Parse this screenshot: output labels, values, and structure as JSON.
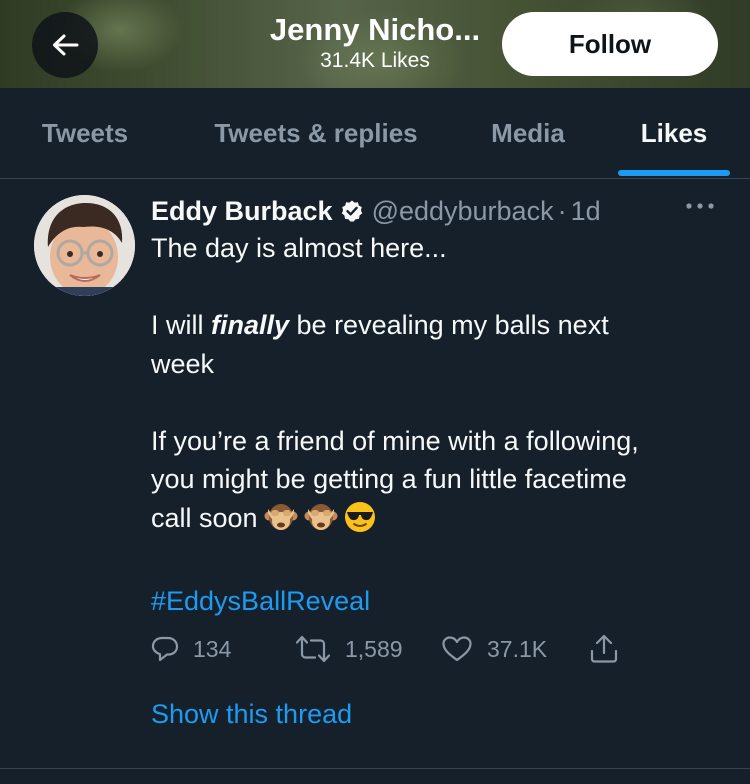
{
  "header": {
    "title": "Jenny Nicho...",
    "subtitle": "31.4K Likes",
    "follow_label": "Follow",
    "back_icon": "arrow-left-icon"
  },
  "tabs": [
    {
      "label": "Tweets",
      "active": false
    },
    {
      "label": "Tweets & replies",
      "active": false
    },
    {
      "label": "Media",
      "active": false
    },
    {
      "label": "Likes",
      "active": true
    }
  ],
  "tweet": {
    "author_name": "Eddy Burback",
    "verified": true,
    "handle": "@eddyburback",
    "separator": "·",
    "age": "1d",
    "lines": {
      "l1": "The day is almost here...",
      "l2_pre": "I will ",
      "l2_em": "finally",
      "l2_post": " be revealing my balls next",
      "l3": "week",
      "l4": "If you’re a friend of mine with a following,",
      "l5": "you might be getting a fun little facetime",
      "l6": "call soon"
    },
    "emojis": [
      "see-no-evil-monkey",
      "see-no-evil-monkey",
      "smiling-face-with-sunglasses"
    ],
    "hashtag": "#EddysBallReveal",
    "replies": "134",
    "retweets": "1,589",
    "likes": "37.1K",
    "show_thread": "Show this thread"
  },
  "colors": {
    "background": "#15202b",
    "accent": "#1d9bf0",
    "muted": "#8b98a5",
    "divider": "#38444d"
  }
}
